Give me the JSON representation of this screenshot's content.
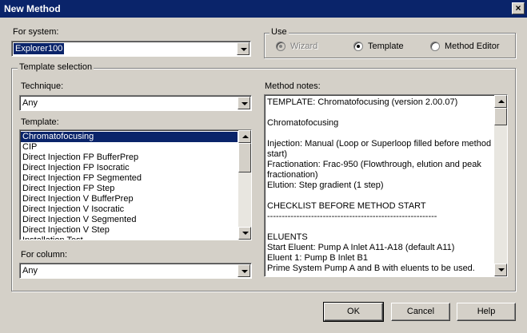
{
  "window": {
    "title": "New Method",
    "close_glyph": "×"
  },
  "system": {
    "label": "For system:",
    "value": "Explorer100"
  },
  "use_group": {
    "title": "Use",
    "options": [
      {
        "label": "Wizard",
        "selected": true,
        "enabled": false
      },
      {
        "label": "Template",
        "selected": true,
        "enabled": true
      },
      {
        "label": "Method Editor",
        "selected": false,
        "enabled": true
      }
    ]
  },
  "template_selection": {
    "title": "Template selection",
    "technique": {
      "label": "Technique:",
      "value": "Any"
    },
    "template": {
      "label": "Template:",
      "items": [
        "Chromatofocusing",
        "CIP",
        "Direct Injection FP BufferPrep",
        "Direct Injection FP Isocratic",
        "Direct Injection FP Segmented",
        "Direct Injection FP Step",
        "Direct Injection V BufferPrep",
        "Direct Injection V Isocratic",
        "Direct Injection V Segmented",
        "Direct Injection V Step",
        "Installation Test"
      ],
      "selected_index": 0
    },
    "column": {
      "label": "For column:",
      "value": "Any"
    }
  },
  "method_notes": {
    "label": "Method notes:",
    "text": "TEMPLATE: Chromatofocusing (version 2.00.07)\n\nChromatofocusing\n\nInjection: Manual (Loop or Superloop filled before method start)\nFractionation: Frac-950 (Flowthrough, elution and peak fractionation)\nElution: Step gradient (1 step)\n\nCHECKLIST BEFORE METHOD START\n----------------------------------------------------------\n\nELUENTS\nStart Eluent: Pump A Inlet A11-A18 (default A11)\nEluent 1: Pump B Inlet B1\nPrime System Pump A and B with eluents to be used. Prime"
  },
  "buttons": {
    "ok": "OK",
    "cancel": "Cancel",
    "help": "Help"
  }
}
